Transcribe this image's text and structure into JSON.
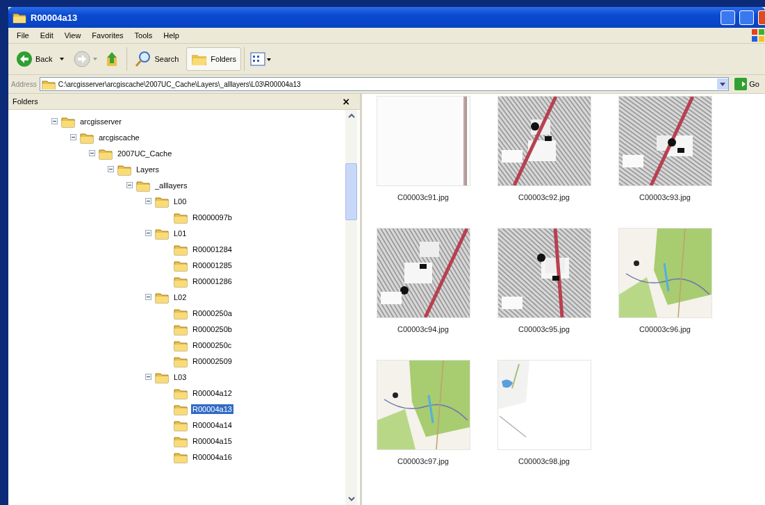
{
  "window": {
    "title": "R00004a13"
  },
  "menu": [
    "File",
    "Edit",
    "View",
    "Favorites",
    "Tools",
    "Help"
  ],
  "toolbar": {
    "back": {
      "label": "Back"
    },
    "search": {
      "label": "Search"
    },
    "folders": {
      "label": "Folders",
      "selected": true
    }
  },
  "address": {
    "label": "Address",
    "value": "C:\\arcgisserver\\arcgiscache\\2007UC_Cache\\Layers\\_alllayers\\L03\\R00004a13",
    "go": "Go"
  },
  "folders_pane": {
    "title": "Folders",
    "close": "×",
    "tree": [
      {
        "label": "arcgisserver",
        "expanded": true,
        "selected": false,
        "children": [
          {
            "label": "arcgiscache",
            "expanded": true,
            "selected": false,
            "children": [
              {
                "label": "2007UC_Cache",
                "expanded": true,
                "selected": false,
                "children": [
                  {
                    "label": "Layers",
                    "expanded": true,
                    "selected": false,
                    "children": [
                      {
                        "label": "_alllayers",
                        "expanded": true,
                        "selected": false,
                        "children": [
                          {
                            "label": "L00",
                            "expanded": true,
                            "selected": false,
                            "children": [
                              {
                                "label": "R0000097b",
                                "selected": false
                              }
                            ]
                          },
                          {
                            "label": "L01",
                            "expanded": true,
                            "selected": false,
                            "children": [
                              {
                                "label": "R00001284",
                                "selected": false
                              },
                              {
                                "label": "R00001285",
                                "selected": false
                              },
                              {
                                "label": "R00001286",
                                "selected": false
                              }
                            ]
                          },
                          {
                            "label": "L02",
                            "expanded": true,
                            "selected": false,
                            "children": [
                              {
                                "label": "R0000250a",
                                "selected": false
                              },
                              {
                                "label": "R0000250b",
                                "selected": false
                              },
                              {
                                "label": "R0000250c",
                                "selected": false
                              },
                              {
                                "label": "R00002509",
                                "selected": false
                              }
                            ]
                          },
                          {
                            "label": "L03",
                            "expanded": true,
                            "selected": false,
                            "children": [
                              {
                                "label": "R00004a12",
                                "selected": false
                              },
                              {
                                "label": "R00004a13",
                                "selected": true
                              },
                              {
                                "label": "R00004a14",
                                "selected": false
                              },
                              {
                                "label": "R00004a15",
                                "selected": false
                              },
                              {
                                "label": "R00004a16",
                                "selected": false
                              }
                            ]
                          }
                        ]
                      }
                    ]
                  }
                ]
              }
            ]
          }
        ]
      }
    ]
  },
  "files": [
    {
      "name": "C00003c91.jpg",
      "kind": "picture"
    },
    {
      "name": "C00003c92.jpg",
      "kind": "picture"
    },
    {
      "name": "C00003c93.jpg",
      "kind": "picture"
    },
    {
      "name": "C00003c94.jpg",
      "kind": "picture"
    },
    {
      "name": "C00003c95.jpg",
      "kind": "picture"
    },
    {
      "name": "C00003c96.jpg",
      "kind": "picture"
    },
    {
      "name": "C00003c97.jpg",
      "kind": "picture"
    },
    {
      "name": "C00003c98.jpg",
      "kind": "picture"
    }
  ]
}
